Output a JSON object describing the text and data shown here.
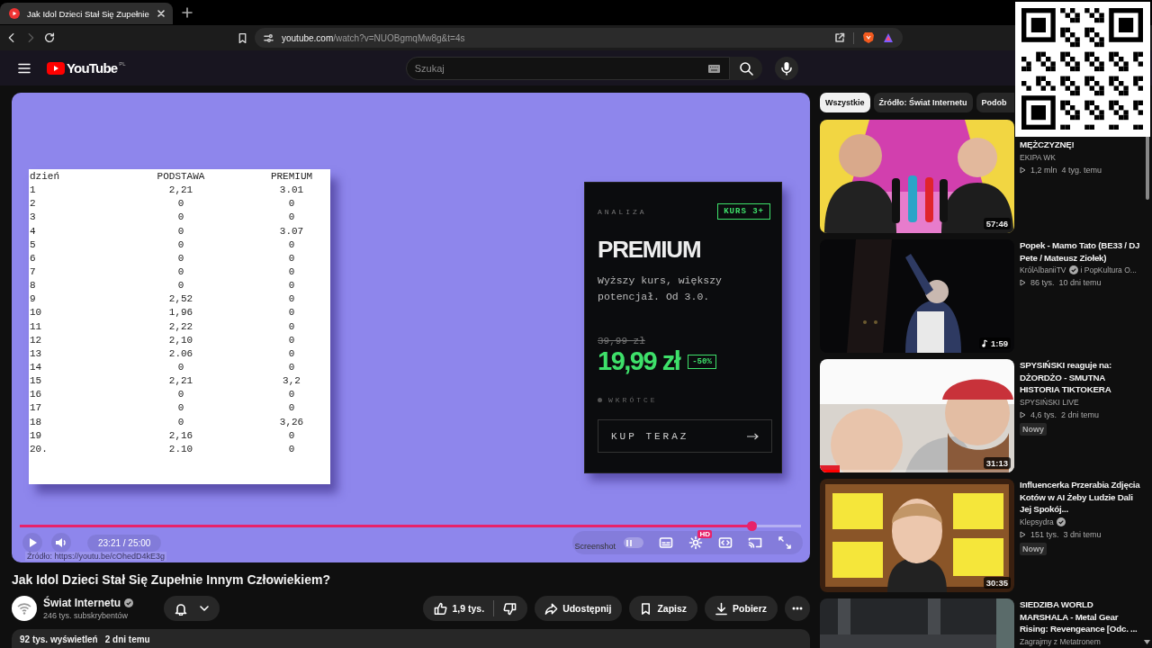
{
  "browser": {
    "tab": {
      "title": "Jak Idol Dzieci Stał Się Zupełnie",
      "selected": true
    },
    "forward_button": {
      "disabled": true
    },
    "address": {
      "host": "youtube.com",
      "path": "/watch?v=NUOBgmqMw8g&t=4s"
    }
  },
  "header": {
    "logo": "YouTube",
    "region": "PL",
    "search": {
      "placeholder": "Szukaj"
    }
  },
  "player": {
    "slide": {
      "table": {
        "columns": [
          "dzień",
          "PODSTAWA",
          "PREMIUM"
        ],
        "rows": [
          [
            "1",
            "2,21",
            "3.01"
          ],
          [
            "2",
            "0",
            "0"
          ],
          [
            "3",
            "0",
            "0"
          ],
          [
            "4",
            "0",
            "3.07"
          ],
          [
            "5",
            "0",
            "0"
          ],
          [
            "6",
            "0",
            "0"
          ],
          [
            "7",
            "0",
            "0"
          ],
          [
            "8",
            "0",
            "0"
          ],
          [
            "9",
            "2,52",
            "0"
          ],
          [
            "10",
            "1,96",
            "0"
          ],
          [
            "11",
            "2,22",
            "0"
          ],
          [
            "12",
            "2,10",
            "0"
          ],
          [
            "13",
            "2.06",
            "0"
          ],
          [
            "14",
            "0",
            "0"
          ],
          [
            "15",
            "2,21",
            "3,2"
          ],
          [
            "16",
            "0",
            "0"
          ],
          [
            "17",
            "0",
            "0"
          ],
          [
            "18",
            "0",
            "3,26"
          ],
          [
            "19",
            "2,16",
            "0"
          ],
          [
            "20.",
            "2.10",
            "0"
          ]
        ]
      },
      "offer": {
        "label": "ANALIZA",
        "badge": "KURS 3+",
        "title": "PREMIUM",
        "description": "Wyższy kurs, większy potencjał. Od 3.0.",
        "old_price": "39,99 zł",
        "price": "19,99 zł",
        "discount": "-50%",
        "status": "WKRÓTCE",
        "button": "KUP TERAZ"
      }
    },
    "progress": {
      "level": 0.937
    },
    "time": "23:21 / 25:00",
    "source": "Źródło: https://youtu.be/cOhedD4kE3g",
    "screenshot_label": "Screenshot",
    "autoplay": {
      "on": false
    },
    "quality_badge": "HD"
  },
  "video": {
    "title": "Jak Idol Dzieci Stał Się Zupełnie Innym Człowiekiem?",
    "channel": {
      "name": "Świat Internetu",
      "verified": true,
      "subscribers": "246 tys. subskrybentów"
    },
    "likes": "1,9 tys.",
    "actions": [
      {
        "kind": "share",
        "label": "Udostępnij"
      },
      {
        "kind": "save",
        "label": "Zapisz"
      },
      {
        "kind": "download",
        "label": "Pobierz"
      }
    ],
    "views": "92 tys. wyświetleń",
    "age": "2 dni temu"
  },
  "sidebar": {
    "chips": [
      {
        "label": "Wszystkie",
        "selected": true
      },
      {
        "label": "Źródło: Świat Internetu",
        "selected": false
      },
      {
        "label": "Podob",
        "selected": false
      }
    ],
    "videos": [
      {
        "title": "MĘŻCZYZNĘ!",
        "channel": "EKIPA WK",
        "views": "1,2 mln",
        "age": "4 tyg. temu",
        "duration": "57:46"
      },
      {
        "title": "Popek - Mamo Tato (BE33 / DJ Pete / Mateusz Ziołek)",
        "channel": "KrólAlbaniiTV",
        "verified": true,
        "channel_extra": "i PopKultura O...",
        "views": "86 tys.",
        "age": "10 dni temu",
        "duration": "1:59",
        "music": true
      },
      {
        "title": "SPYSIŃSKI reaguje na: DŻORDŻO - SMUTNA HISTORIA TIKTOKERA",
        "channel": "SPYSIŃSKI LIVE",
        "views": "4,6 tys.",
        "age": "2 dni temu",
        "badge": "Nowy",
        "duration": "31:13",
        "watched": {
          "level": 0.1
        }
      },
      {
        "title": "Influencerka Przerabia Zdjęcia Kotów w AI Żeby Ludzie Dali Jej Spokój...",
        "channel": "Klepsydra",
        "verified": true,
        "views": "151 tys.",
        "age": "3 dni temu",
        "badge": "Nowy",
        "duration": "30:35"
      },
      {
        "title": "SIEDZIBA WORLD MARSHALA - Metal Gear Rising: Revengeance [Odc. ...",
        "channel": "Zagrajmy z Metatronem"
      }
    ]
  }
}
